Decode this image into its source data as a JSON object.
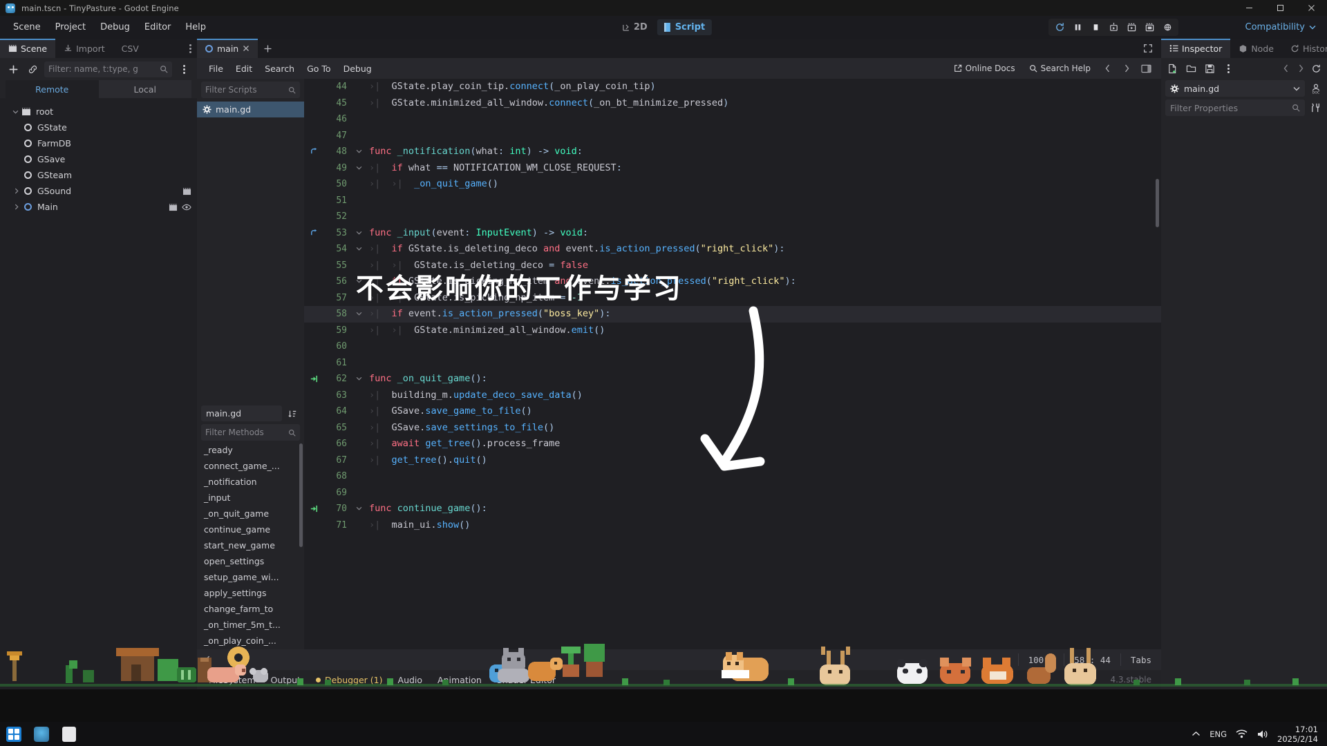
{
  "window": {
    "title": "main.tscn - TinyPasture - Godot Engine",
    "icon": "godot-icon",
    "minimize": "minimize-icon",
    "maximize": "maximize-icon",
    "close": "close-icon"
  },
  "menubar": {
    "items": [
      "Scene",
      "Project",
      "Debug",
      "Editor",
      "Help"
    ],
    "mode_tabs": [
      {
        "label": "2D",
        "icon": "2d-icon",
        "active": false
      },
      {
        "label": "Script",
        "icon": "script-icon",
        "active": true
      }
    ],
    "play_buttons": [
      "run-project-icon",
      "pause-icon",
      "stop-icon",
      "run-current-scene-icon",
      "run-specific-scene-icon",
      "movie-writer-icon",
      "remote-debug-icon"
    ],
    "renderer": "Compatibility"
  },
  "scene_dock": {
    "tabs": [
      {
        "label": "Scene",
        "icon": "scene-icon",
        "active": true
      },
      {
        "label": "Import",
        "icon": "import-icon",
        "active": false
      },
      {
        "label": "CSV",
        "icon": "csv-icon",
        "active": false
      }
    ],
    "toolbar": {
      "add": "plus-icon",
      "link": "link-icon"
    },
    "filter_placeholder": "Filter: name, t:type, g",
    "filter_icon": "search-icon",
    "view_tabs": [
      {
        "label": "Remote",
        "active": true
      },
      {
        "label": "Local",
        "active": false
      }
    ],
    "tree": [
      {
        "label": "root",
        "depth": 0,
        "twisty": "down",
        "icon": "scene-root-icon",
        "selected": false,
        "extras": []
      },
      {
        "label": "GState",
        "depth": 1,
        "twisty": "",
        "icon": "node-icon",
        "selected": false,
        "extras": []
      },
      {
        "label": "FarmDB",
        "depth": 1,
        "twisty": "",
        "icon": "node-icon",
        "selected": false,
        "extras": []
      },
      {
        "label": "GSave",
        "depth": 1,
        "twisty": "",
        "icon": "node-icon",
        "selected": false,
        "extras": []
      },
      {
        "label": "GSteam",
        "depth": 1,
        "twisty": "",
        "icon": "node-icon",
        "selected": false,
        "extras": []
      },
      {
        "label": "GSound",
        "depth": 1,
        "twisty": "right",
        "icon": "node-icon",
        "selected": false,
        "extras": [
          "scene-file-icon"
        ]
      },
      {
        "label": "Main",
        "depth": 1,
        "twisty": "right",
        "icon": "node-icon-blue",
        "selected": false,
        "extras": [
          "scene-file-icon",
          "visibility-icon"
        ]
      }
    ]
  },
  "script_editor": {
    "tab": {
      "label": "main",
      "icon": "script-tab-icon",
      "close": "close-icon"
    },
    "new_tab": "plus-icon",
    "expand": "fullscreen-icon",
    "menu": [
      "File",
      "Edit",
      "Search",
      "Go To",
      "Debug"
    ],
    "online_docs": {
      "label": "Online Docs",
      "icon": "external-link-icon"
    },
    "search_help": {
      "label": "Search Help",
      "icon": "search-icon"
    },
    "nav_prev": "chevron-left-icon",
    "nav_next": "chevron-right-icon",
    "panel_toggle": "panel-toggle-icon",
    "script_list": {
      "filter_placeholder": "Filter Scripts",
      "filter_icon": "search-icon",
      "items": [
        {
          "label": "main.gd",
          "icon": "gdscript-icon",
          "active": true
        }
      ],
      "current_name": "main.gd",
      "sort_icon": "sort-icon",
      "methods_placeholder": "Filter Methods",
      "methods": [
        "_ready",
        "connect_game_...",
        "_notification",
        "_input",
        "_on_quit_game",
        "continue_game",
        "start_new_game",
        "open_settings",
        "setup_game_wi...",
        "apply_settings",
        "change_farm_to",
        "_on_timer_5m_t...",
        "_on_play_coin_..."
      ]
    },
    "code": [
      {
        "num": 44,
        "fold": "",
        "bp": "",
        "hl": false,
        "indent": 1,
        "tokens": [
          {
            "t": "GState.",
            "c": "var"
          },
          {
            "t": "play_coin_tip",
            "c": "var"
          },
          {
            "t": ".",
            "c": "var"
          },
          {
            "t": "connect",
            "c": "fn"
          },
          {
            "t": "(",
            "c": "op"
          },
          {
            "t": "_on_play_coin_tip",
            "c": "var"
          },
          {
            "t": ")",
            "c": "op"
          }
        ]
      },
      {
        "num": 45,
        "fold": "",
        "bp": "",
        "hl": false,
        "indent": 1,
        "tokens": [
          {
            "t": "GState.minimized_all_window.",
            "c": "var"
          },
          {
            "t": "connect",
            "c": "fn"
          },
          {
            "t": "(",
            "c": "op"
          },
          {
            "t": "_on_bt_minimize_pressed",
            "c": "var"
          },
          {
            "t": ")",
            "c": "op"
          }
        ]
      },
      {
        "num": 46,
        "fold": "",
        "bp": "",
        "hl": false,
        "indent": 0,
        "tokens": []
      },
      {
        "num": 47,
        "fold": "",
        "bp": "",
        "hl": false,
        "indent": 0,
        "tokens": []
      },
      {
        "num": 48,
        "fold": "down",
        "bp": "override",
        "hl": false,
        "indent": 0,
        "tokens": [
          {
            "t": "func",
            "c": "kw"
          },
          {
            "t": " ",
            "c": "var"
          },
          {
            "t": "_notification",
            "c": "fndef"
          },
          {
            "t": "(",
            "c": "op"
          },
          {
            "t": "what",
            "c": "var"
          },
          {
            "t": ": ",
            "c": "op"
          },
          {
            "t": "int",
            "c": "typ"
          },
          {
            "t": ") -> ",
            "c": "op"
          },
          {
            "t": "void",
            "c": "typ"
          },
          {
            "t": ":",
            "c": "op"
          }
        ]
      },
      {
        "num": 49,
        "fold": "down",
        "bp": "",
        "hl": false,
        "indent": 1,
        "tokens": [
          {
            "t": "if",
            "c": "ctl"
          },
          {
            "t": " what ",
            "c": "var"
          },
          {
            "t": "==",
            "c": "op"
          },
          {
            "t": " NOTIFICATION_WM_CLOSE_REQUEST",
            "c": "var"
          },
          {
            "t": ":",
            "c": "op"
          }
        ]
      },
      {
        "num": 50,
        "fold": "",
        "bp": "",
        "hl": false,
        "indent": 2,
        "tokens": [
          {
            "t": "_on_quit_game",
            "c": "fn"
          },
          {
            "t": "()",
            "c": "op"
          }
        ]
      },
      {
        "num": 51,
        "fold": "",
        "bp": "",
        "hl": false,
        "indent": 0,
        "tokens": []
      },
      {
        "num": 52,
        "fold": "",
        "bp": "",
        "hl": false,
        "indent": 0,
        "tokens": []
      },
      {
        "num": 53,
        "fold": "down",
        "bp": "override",
        "hl": false,
        "indent": 0,
        "tokens": [
          {
            "t": "func",
            "c": "kw"
          },
          {
            "t": " ",
            "c": "var"
          },
          {
            "t": "_input",
            "c": "fndef"
          },
          {
            "t": "(",
            "c": "op"
          },
          {
            "t": "event",
            "c": "var"
          },
          {
            "t": ": ",
            "c": "op"
          },
          {
            "t": "InputEvent",
            "c": "typ"
          },
          {
            "t": ") -> ",
            "c": "op"
          },
          {
            "t": "void",
            "c": "typ"
          },
          {
            "t": ":",
            "c": "op"
          }
        ]
      },
      {
        "num": 54,
        "fold": "down",
        "bp": "",
        "hl": false,
        "indent": 1,
        "tokens": [
          {
            "t": "if",
            "c": "ctl"
          },
          {
            "t": " GState.is_deleting_deco ",
            "c": "var"
          },
          {
            "t": "and",
            "c": "ctl"
          },
          {
            "t": " event.",
            "c": "var"
          },
          {
            "t": "is_action_pressed",
            "c": "fn"
          },
          {
            "t": "(",
            "c": "op"
          },
          {
            "t": "\"right_click\"",
            "c": "str"
          },
          {
            "t": "):",
            "c": "op"
          }
        ]
      },
      {
        "num": 55,
        "fold": "",
        "bp": "",
        "hl": false,
        "indent": 2,
        "tokens": [
          {
            "t": "GState.is_deleting_deco ",
            "c": "var"
          },
          {
            "t": "=",
            "c": "op"
          },
          {
            "t": " ",
            "c": "var"
          },
          {
            "t": "false",
            "c": "kw"
          }
        ]
      },
      {
        "num": 56,
        "fold": "down",
        "bp": "",
        "hl": false,
        "indent": 1,
        "tokens": [
          {
            "t": "if",
            "c": "ctl"
          },
          {
            "t": " GState.is_picking_hp_item ",
            "c": "var"
          },
          {
            "t": "and",
            "c": "ctl"
          },
          {
            "t": " event.",
            "c": "var"
          },
          {
            "t": "is_action_pressed",
            "c": "fn"
          },
          {
            "t": "(",
            "c": "op"
          },
          {
            "t": "\"right_click\"",
            "c": "str"
          },
          {
            "t": "):",
            "c": "op"
          }
        ]
      },
      {
        "num": 57,
        "fold": "",
        "bp": "",
        "hl": false,
        "indent": 2,
        "tokens": [
          {
            "t": "GState.is_picking_hp_item ",
            "c": "var"
          },
          {
            "t": "=",
            "c": "op"
          },
          {
            "t": " ",
            "c": "var"
          },
          {
            "t": "-1",
            "c": "num"
          }
        ]
      },
      {
        "num": 58,
        "fold": "down",
        "bp": "",
        "hl": true,
        "indent": 1,
        "tokens": [
          {
            "t": "if",
            "c": "ctl"
          },
          {
            "t": " event.",
            "c": "var"
          },
          {
            "t": "is_action_pressed",
            "c": "fn"
          },
          {
            "t": "(",
            "c": "op"
          },
          {
            "t": "\"boss_key\"",
            "c": "str"
          },
          {
            "t": "):",
            "c": "op"
          }
        ]
      },
      {
        "num": 59,
        "fold": "",
        "bp": "",
        "hl": false,
        "indent": 2,
        "tokens": [
          {
            "t": "GState.minimized_all_window.",
            "c": "var"
          },
          {
            "t": "emit",
            "c": "fn"
          },
          {
            "t": "()",
            "c": "op"
          }
        ]
      },
      {
        "num": 60,
        "fold": "",
        "bp": "",
        "hl": false,
        "indent": 0,
        "tokens": []
      },
      {
        "num": 61,
        "fold": "",
        "bp": "",
        "hl": false,
        "indent": 0,
        "tokens": []
      },
      {
        "num": 62,
        "fold": "down",
        "bp": "signal",
        "hl": false,
        "indent": 0,
        "tokens": [
          {
            "t": "func",
            "c": "kw"
          },
          {
            "t": " ",
            "c": "var"
          },
          {
            "t": "_on_quit_game",
            "c": "fndef"
          },
          {
            "t": "():",
            "c": "op"
          }
        ]
      },
      {
        "num": 63,
        "fold": "",
        "bp": "",
        "hl": false,
        "indent": 1,
        "tokens": [
          {
            "t": "building_m.",
            "c": "var"
          },
          {
            "t": "update_deco_save_data",
            "c": "fn"
          },
          {
            "t": "()",
            "c": "op"
          }
        ]
      },
      {
        "num": 64,
        "fold": "",
        "bp": "",
        "hl": false,
        "indent": 1,
        "tokens": [
          {
            "t": "GSave.",
            "c": "var"
          },
          {
            "t": "save_game_to_file",
            "c": "fn"
          },
          {
            "t": "()",
            "c": "op"
          }
        ]
      },
      {
        "num": 65,
        "fold": "",
        "bp": "",
        "hl": false,
        "indent": 1,
        "tokens": [
          {
            "t": "GSave.",
            "c": "var"
          },
          {
            "t": "save_settings_to_file",
            "c": "fn"
          },
          {
            "t": "()",
            "c": "op"
          }
        ]
      },
      {
        "num": 66,
        "fold": "",
        "bp": "",
        "hl": false,
        "indent": 1,
        "tokens": [
          {
            "t": "await",
            "c": "kw"
          },
          {
            "t": " ",
            "c": "var"
          },
          {
            "t": "get_tree",
            "c": "fn"
          },
          {
            "t": "()",
            "c": "op"
          },
          {
            "t": ".process_frame",
            "c": "var"
          }
        ]
      },
      {
        "num": 67,
        "fold": "",
        "bp": "",
        "hl": false,
        "indent": 1,
        "tokens": [
          {
            "t": "get_tree",
            "c": "fn"
          },
          {
            "t": "()",
            "c": "op"
          },
          {
            "t": ".",
            "c": "var"
          },
          {
            "t": "quit",
            "c": "fn"
          },
          {
            "t": "()",
            "c": "op"
          }
        ]
      },
      {
        "num": 68,
        "fold": "",
        "bp": "",
        "hl": false,
        "indent": 0,
        "tokens": []
      },
      {
        "num": 69,
        "fold": "",
        "bp": "",
        "hl": false,
        "indent": 0,
        "tokens": []
      },
      {
        "num": 70,
        "fold": "down",
        "bp": "signal",
        "hl": false,
        "indent": 0,
        "tokens": [
          {
            "t": "func",
            "c": "kw"
          },
          {
            "t": " ",
            "c": "var"
          },
          {
            "t": "continue_game",
            "c": "fndef"
          },
          {
            "t": "():",
            "c": "op"
          }
        ]
      },
      {
        "num": 71,
        "fold": "",
        "bp": "",
        "hl": false,
        "indent": 1,
        "tokens": [
          {
            "t": "main_ui.",
            "c": "var"
          },
          {
            "t": "show",
            "c": "fn"
          },
          {
            "t": "()",
            "c": "op"
          }
        ]
      }
    ],
    "status": {
      "zoom": "100 %",
      "line_col": "58 : 44",
      "indent": "Tabs"
    }
  },
  "bottom_panels": [
    {
      "label": "FileSystem",
      "badge": "",
      "warn": false
    },
    {
      "label": "Output",
      "badge": "",
      "warn": false
    },
    {
      "label": "Debugger (1)",
      "badge": "dot",
      "warn": true
    },
    {
      "label": "Audio",
      "badge": "",
      "warn": false
    },
    {
      "label": "Animation",
      "badge": "",
      "warn": false
    },
    {
      "label": "Shader Editor",
      "badge": "",
      "warn": false
    }
  ],
  "version": "4.3.stable",
  "inspector": {
    "tabs": [
      {
        "label": "Inspector",
        "icon": "inspector-icon",
        "active": true
      },
      {
        "label": "Node",
        "icon": "node-3d-icon",
        "active": false
      },
      {
        "label": "History",
        "icon": "history-icon",
        "active": false
      }
    ],
    "kebab": "kebab-icon",
    "toolbar_left": [
      "new-resource-icon",
      "open-resource-icon",
      "save-resource-icon",
      "resource-menu-icon"
    ],
    "toolbar_right": [
      "chevron-left-icon",
      "chevron-right-icon",
      "history-icon"
    ],
    "resource": {
      "label": "main.gd",
      "icon": "gdscript-icon",
      "dropdown": "chevron-down-icon",
      "doc": "open-docs-icon"
    },
    "filter_placeholder": "Filter Properties",
    "filter_icon": "search-icon",
    "settings_icon": "tools-icon"
  },
  "overlay": {
    "caption": "不会影响你的工作与学习",
    "arrow": "curved-down-left-arrow"
  },
  "taskbar": {
    "start": "windows-start-icon",
    "pinned": [
      "godot-taskbar-icon",
      "browser-taskbar-icon"
    ],
    "tray": {
      "chevron": "chevron-up-icon",
      "language": "ENG",
      "wifi": "wifi-icon",
      "volume": "volume-icon"
    },
    "clock": {
      "time": "17:01",
      "date": "2025/2/14"
    }
  },
  "colors": {
    "accent": "#4c8fc9",
    "link": "#63b3ed",
    "warning": "#e8c468",
    "editor_bg": "#1f1f23",
    "panel_bg": "#242428",
    "selection": "#3d566e"
  }
}
